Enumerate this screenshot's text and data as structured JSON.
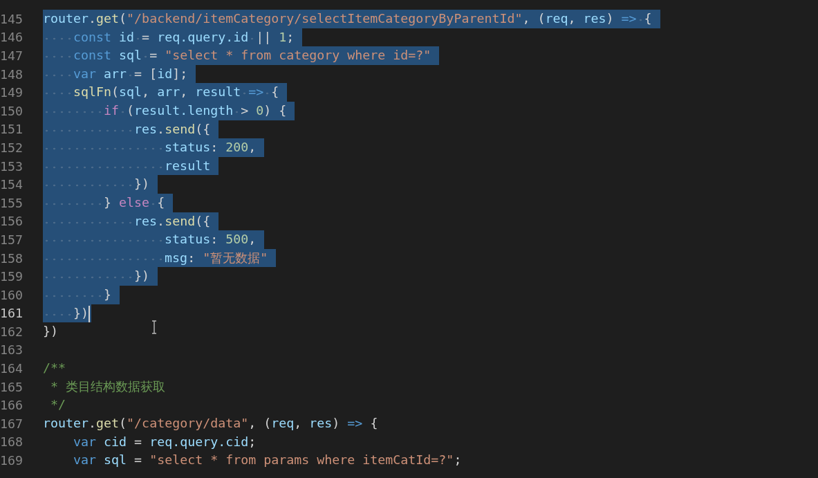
{
  "editor": {
    "lines": [
      {
        "number": "145",
        "highlighted": true,
        "current": false,
        "tokens": [
          {
            "kind": "var",
            "text": "router"
          },
          {
            "kind": "plain",
            "text": "."
          },
          {
            "kind": "fn",
            "text": "get"
          },
          {
            "kind": "plain",
            "text": "("
          },
          {
            "kind": "str",
            "text": "\"/backend/itemCategory/selectItemCategoryByParentId\""
          },
          {
            "kind": "plain",
            "text": ", ("
          },
          {
            "kind": "var",
            "text": "req"
          },
          {
            "kind": "plain",
            "text": ", "
          },
          {
            "kind": "var",
            "text": "res"
          },
          {
            "kind": "plain",
            "text": ") "
          },
          {
            "kind": "kw",
            "text": "=>"
          },
          {
            "kind": "plain",
            "text": " {"
          }
        ]
      },
      {
        "number": "146",
        "highlighted": true,
        "current": false,
        "tokens": [
          {
            "kind": "kw",
            "text": "    const "
          },
          {
            "kind": "var",
            "text": "id"
          },
          {
            "kind": "plain",
            "text": " = "
          },
          {
            "kind": "var",
            "text": "req.query.id"
          },
          {
            "kind": "plain",
            "text": " || "
          },
          {
            "kind": "num",
            "text": "1"
          },
          {
            "kind": "plain",
            "text": ";"
          }
        ]
      },
      {
        "number": "147",
        "highlighted": true,
        "current": false,
        "tokens": [
          {
            "kind": "kw",
            "text": "    const "
          },
          {
            "kind": "var",
            "text": "sql"
          },
          {
            "kind": "plain",
            "text": " = "
          },
          {
            "kind": "str",
            "text": "\"select * from category where id=?\""
          }
        ]
      },
      {
        "number": "148",
        "highlighted": true,
        "current": false,
        "tokens": [
          {
            "kind": "kw",
            "text": "    var "
          },
          {
            "kind": "var",
            "text": "arr"
          },
          {
            "kind": "plain",
            "text": " = ["
          },
          {
            "kind": "var",
            "text": "id"
          },
          {
            "kind": "plain",
            "text": "];"
          }
        ]
      },
      {
        "number": "149",
        "highlighted": true,
        "current": false,
        "tokens": [
          {
            "kind": "fn",
            "text": "    sqlFn"
          },
          {
            "kind": "plain",
            "text": "("
          },
          {
            "kind": "var",
            "text": "sql"
          },
          {
            "kind": "plain",
            "text": ", "
          },
          {
            "kind": "var",
            "text": "arr"
          },
          {
            "kind": "plain",
            "text": ", "
          },
          {
            "kind": "var",
            "text": "result"
          },
          {
            "kind": "kw",
            "text": " =>"
          },
          {
            "kind": "plain",
            "text": " {"
          }
        ]
      },
      {
        "number": "150",
        "highlighted": true,
        "current": false,
        "tokens": [
          {
            "kind": "ctrl",
            "text": "        if"
          },
          {
            "kind": "plain",
            "text": " ("
          },
          {
            "kind": "var",
            "text": "result.length"
          },
          {
            "kind": "plain",
            "text": " > "
          },
          {
            "kind": "num",
            "text": "0"
          },
          {
            "kind": "plain",
            "text": ") {"
          }
        ]
      },
      {
        "number": "151",
        "highlighted": true,
        "current": false,
        "tokens": [
          {
            "kind": "var",
            "text": "            res"
          },
          {
            "kind": "plain",
            "text": "."
          },
          {
            "kind": "fn",
            "text": "send"
          },
          {
            "kind": "plain",
            "text": "({"
          }
        ]
      },
      {
        "number": "152",
        "highlighted": true,
        "current": false,
        "tokens": [
          {
            "kind": "var",
            "text": "                status"
          },
          {
            "kind": "plain",
            "text": ": "
          },
          {
            "kind": "num",
            "text": "200"
          },
          {
            "kind": "plain",
            "text": ","
          }
        ]
      },
      {
        "number": "153",
        "highlighted": true,
        "current": false,
        "tokens": [
          {
            "kind": "var",
            "text": "                result"
          }
        ]
      },
      {
        "number": "154",
        "highlighted": true,
        "current": false,
        "tokens": [
          {
            "kind": "plain",
            "text": "            })"
          }
        ]
      },
      {
        "number": "155",
        "highlighted": true,
        "current": false,
        "tokens": [
          {
            "kind": "plain",
            "text": "        } "
          },
          {
            "kind": "ctrl",
            "text": "else"
          },
          {
            "kind": "plain",
            "text": " {"
          }
        ]
      },
      {
        "number": "156",
        "highlighted": true,
        "current": false,
        "tokens": [
          {
            "kind": "var",
            "text": "            res"
          },
          {
            "kind": "plain",
            "text": "."
          },
          {
            "kind": "fn",
            "text": "send"
          },
          {
            "kind": "plain",
            "text": "({"
          }
        ]
      },
      {
        "number": "157",
        "highlighted": true,
        "current": false,
        "tokens": [
          {
            "kind": "var",
            "text": "                status"
          },
          {
            "kind": "plain",
            "text": ": "
          },
          {
            "kind": "num",
            "text": "500"
          },
          {
            "kind": "plain",
            "text": ","
          }
        ]
      },
      {
        "number": "158",
        "highlighted": true,
        "current": false,
        "tokens": [
          {
            "kind": "var",
            "text": "                msg"
          },
          {
            "kind": "plain",
            "text": ": "
          },
          {
            "kind": "str",
            "text": "\"暂无数据\""
          }
        ]
      },
      {
        "number": "159",
        "highlighted": true,
        "current": false,
        "tokens": [
          {
            "kind": "plain",
            "text": "            })"
          }
        ]
      },
      {
        "number": "160",
        "highlighted": true,
        "current": false,
        "tokens": [
          {
            "kind": "plain",
            "text": "        }"
          }
        ]
      },
      {
        "number": "161",
        "highlighted": true,
        "current": true,
        "tokens": [
          {
            "kind": "plain",
            "text": "    })"
          }
        ]
      },
      {
        "number": "162",
        "highlighted": false,
        "current": false,
        "tokens": [
          {
            "kind": "plain",
            "text": "})"
          }
        ]
      },
      {
        "number": "163",
        "current": false
      },
      {
        "number": "164",
        "highlighted": false,
        "current": false,
        "tokens": [
          {
            "kind": "comment",
            "text": "/**"
          }
        ]
      },
      {
        "number": "165",
        "highlighted": false,
        "current": false,
        "tokens": [
          {
            "kind": "comment",
            "text": " * 类目结构数据获取"
          }
        ]
      },
      {
        "number": "166",
        "highlighted": false,
        "current": false,
        "tokens": [
          {
            "kind": "comment",
            "text": " */"
          }
        ]
      },
      {
        "number": "167",
        "highlighted": false,
        "current": false,
        "tokens": [
          {
            "kind": "var",
            "text": "router"
          },
          {
            "kind": "plain",
            "text": "."
          },
          {
            "kind": "fn",
            "text": "get"
          },
          {
            "kind": "plain",
            "text": "("
          },
          {
            "kind": "str",
            "text": "\"/category/data\""
          },
          {
            "kind": "plain",
            "text": ", ("
          },
          {
            "kind": "var",
            "text": "req"
          },
          {
            "kind": "plain",
            "text": ", "
          },
          {
            "kind": "var",
            "text": "res"
          },
          {
            "kind": "plain",
            "text": ") "
          },
          {
            "kind": "kw",
            "text": "=>"
          },
          {
            "kind": "plain",
            "text": " {"
          }
        ]
      },
      {
        "number": "168",
        "highlighted": false,
        "current": false,
        "tokens": [
          {
            "kind": "kw",
            "text": "    var "
          },
          {
            "kind": "var",
            "text": "cid"
          },
          {
            "kind": "plain",
            "text": " = "
          },
          {
            "kind": "var",
            "text": "req.query.cid"
          },
          {
            "kind": "plain",
            "text": ";"
          }
        ]
      },
      {
        "number": "169",
        "highlighted": false,
        "current": false,
        "tokens": [
          {
            "kind": "kw",
            "text": "    var "
          },
          {
            "kind": "var",
            "text": "sql"
          },
          {
            "kind": "plain",
            "text": " = "
          },
          {
            "kind": "str",
            "text": "\"select * from params where itemCatId=?\""
          },
          {
            "kind": "plain",
            "text": ";"
          }
        ]
      }
    ]
  }
}
